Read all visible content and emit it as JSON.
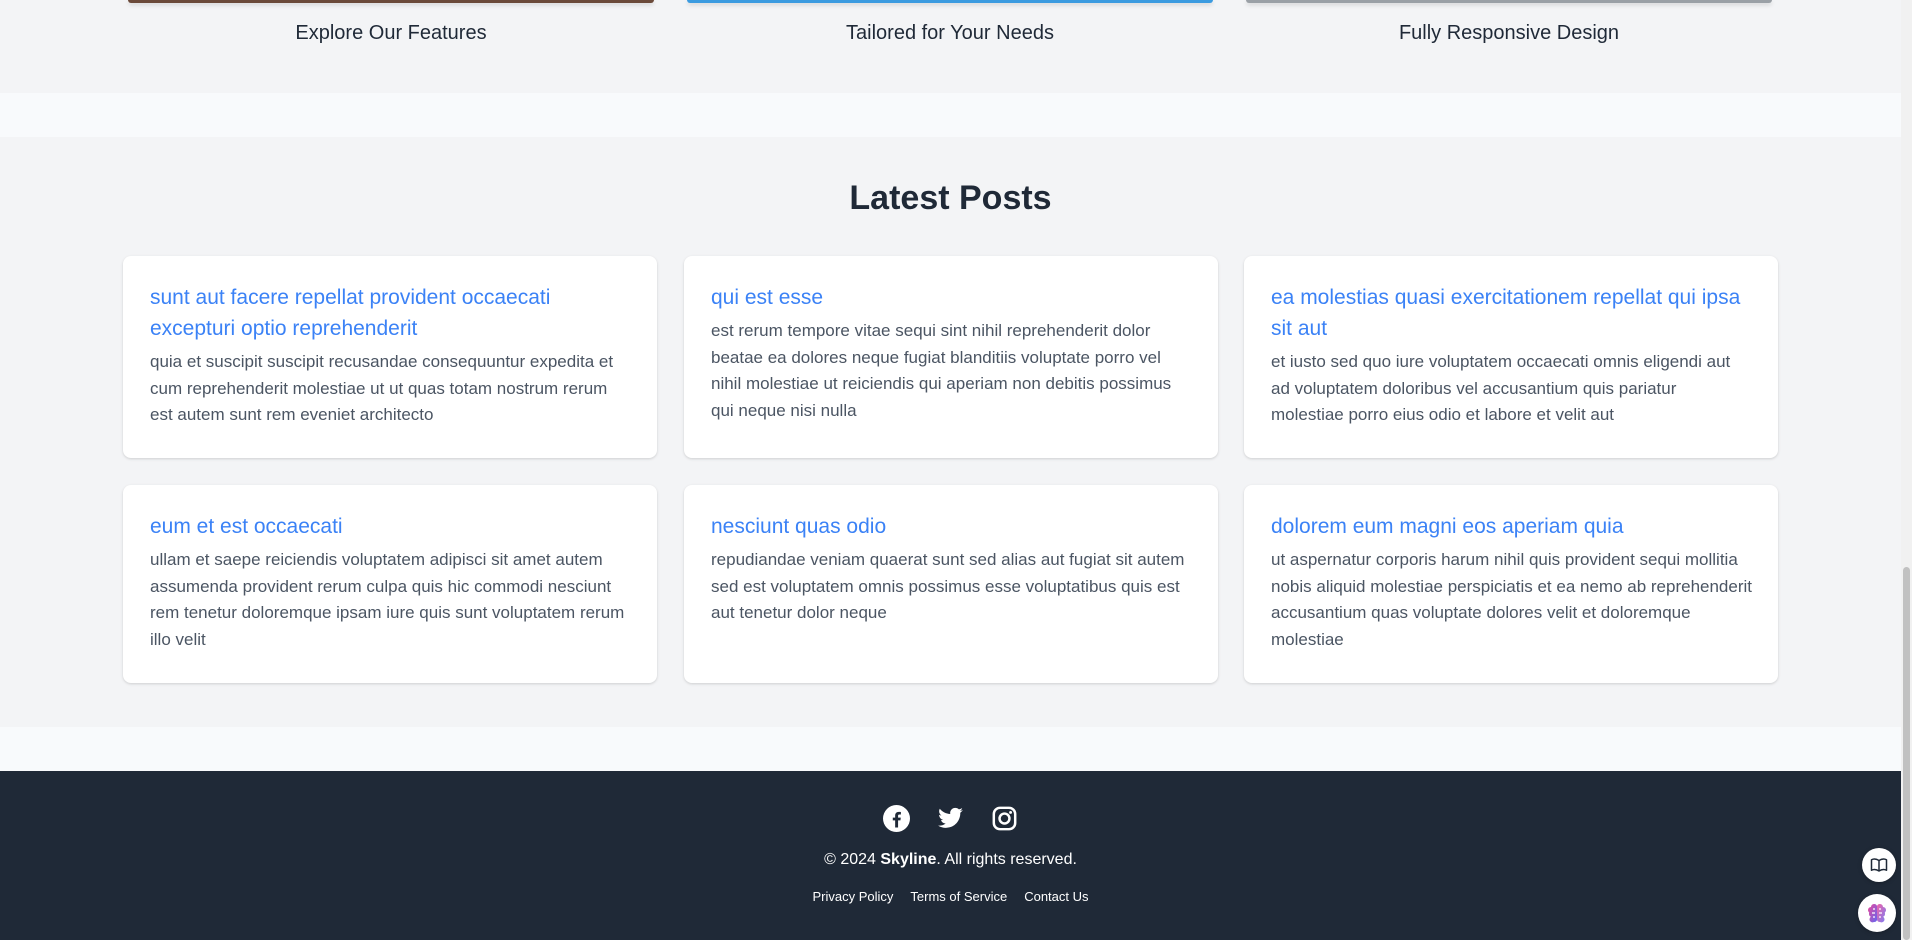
{
  "features": {
    "items": [
      {
        "title": "Explore Our Features",
        "edge_color": "#6b4a3a"
      },
      {
        "title": "Tailored for Your Needs",
        "edge_color": "#3b9be0"
      },
      {
        "title": "Fully Responsive Design",
        "edge_color": "#9aa0a6"
      }
    ]
  },
  "posts": {
    "heading": "Latest Posts",
    "items": [
      {
        "title": "sunt aut facere repellat provident occaecati excepturi optio reprehenderit",
        "body": "quia et suscipit suscipit recusandae consequuntur expedita et cum reprehenderit molestiae ut ut quas totam nostrum rerum est autem sunt rem eveniet architecto"
      },
      {
        "title": "qui est esse",
        "body": "est rerum tempore vitae sequi sint nihil reprehenderit dolor beatae ea dolores neque fugiat blanditiis voluptate porro vel nihil molestiae ut reiciendis qui aperiam non debitis possimus qui neque nisi nulla"
      },
      {
        "title": "ea molestias quasi exercitationem repellat qui ipsa sit aut",
        "body": "et iusto sed quo iure voluptatem occaecati omnis eligendi aut ad voluptatem doloribus vel accusantium quis pariatur molestiae porro eius odio et labore et velit aut"
      },
      {
        "title": "eum et est occaecati",
        "body": "ullam et saepe reiciendis voluptatem adipisci sit amet autem assumenda provident rerum culpa quis hic commodi nesciunt rem tenetur doloremque ipsam iure quis sunt voluptatem rerum illo velit"
      },
      {
        "title": "nesciunt quas odio",
        "body": "repudiandae veniam quaerat sunt sed alias aut fugiat sit autem sed est voluptatem omnis possimus esse voluptatibus quis est aut tenetur dolor neque"
      },
      {
        "title": "dolorem eum magni eos aperiam quia",
        "body": "ut aspernatur corporis harum nihil quis provident sequi mollitia nobis aliquid molestiae perspiciatis et ea nemo ab reprehenderit accusantium quas voluptate dolores velit et doloremque molestiae"
      }
    ]
  },
  "footer": {
    "socials": [
      "facebook-icon",
      "twitter-icon",
      "instagram-icon"
    ],
    "copyright_prefix": "© 2024 ",
    "brand": "Skyline",
    "copyright_suffix": ". All rights reserved.",
    "links": [
      "Privacy Policy",
      "Terms of Service",
      "Contact Us"
    ]
  },
  "widgets": [
    "book-icon",
    "brain-icon"
  ],
  "colors": {
    "link_blue": "#3b82f6",
    "footer_bg": "#1f2937",
    "page_bg": "#f3f4f6"
  }
}
